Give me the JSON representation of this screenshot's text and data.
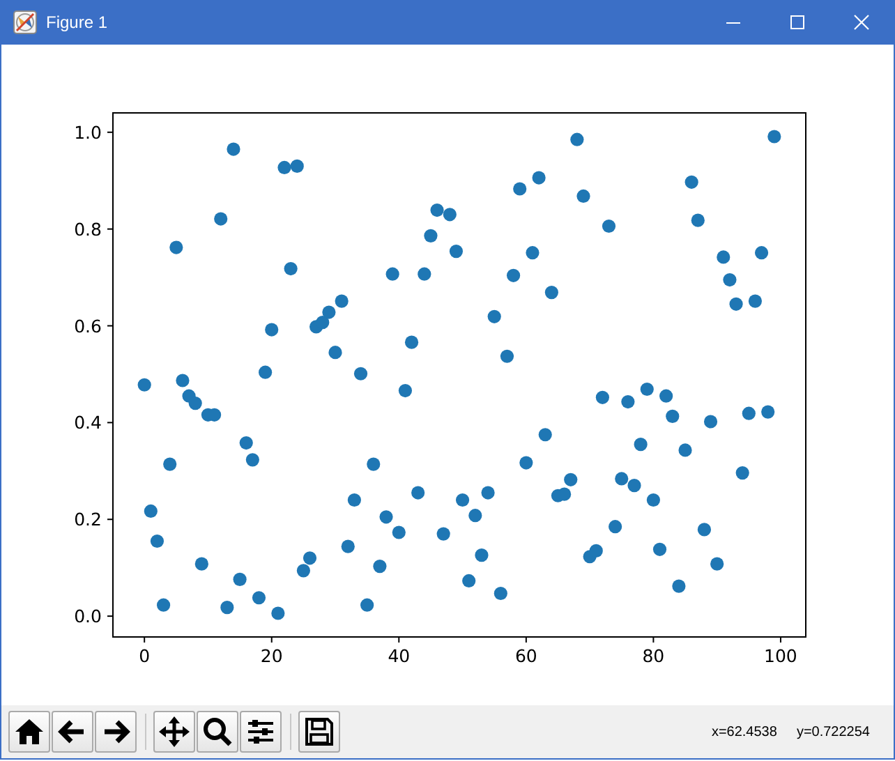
{
  "window": {
    "title": "Figure 1",
    "controls": [
      {
        "kind": "minimize"
      },
      {
        "kind": "maximize"
      },
      {
        "kind": "close"
      }
    ]
  },
  "plot": {
    "chart_data": {
      "type": "scatter",
      "xlim": [
        -4.95,
        103.95
      ],
      "ylim": [
        -0.043,
        1.04
      ],
      "xticks": [
        0,
        20,
        40,
        60,
        80,
        100
      ],
      "yticks": [
        {
          "value": 0,
          "label": "0.0"
        },
        {
          "value": 0.2,
          "label": "0.2"
        },
        {
          "value": 0.4,
          "label": "0.4"
        },
        {
          "value": 0.6,
          "label": "0.6"
        },
        {
          "value": 0.8,
          "label": "0.8"
        },
        {
          "value": 1,
          "label": "1.0"
        }
      ],
      "x": [
        0,
        1,
        2,
        3,
        4,
        5,
        6,
        7,
        8,
        9,
        10,
        11,
        12,
        13,
        14,
        15,
        16,
        17,
        18,
        19,
        20,
        21,
        22,
        23,
        24,
        25,
        26,
        27,
        28,
        29,
        30,
        31,
        32,
        33,
        34,
        35,
        36,
        37,
        38,
        39,
        40,
        41,
        42,
        43,
        44,
        45,
        46,
        47,
        48,
        49,
        50,
        51,
        52,
        53,
        54,
        55,
        56,
        57,
        58,
        59,
        60,
        61,
        62,
        63,
        64,
        65,
        66,
        67,
        68,
        69,
        70,
        71,
        72,
        73,
        74,
        75,
        76,
        77,
        78,
        79,
        80,
        81,
        82,
        83,
        84,
        85,
        86,
        87,
        88,
        89,
        90,
        91,
        92,
        93,
        94,
        95,
        96,
        97,
        98,
        99
      ],
      "series": [
        {
          "color": "#1f77b4",
          "values": [
            0.478,
            0.217,
            0.155,
            0.023,
            0.314,
            0.762,
            0.487,
            0.455,
            0.44,
            0.108,
            0.416,
            0.416,
            0.821,
            0.018,
            0.965,
            0.076,
            0.358,
            0.323,
            0.038,
            0.504,
            0.592,
            0.006,
            0.927,
            0.718,
            0.93,
            0.094,
            0.12,
            0.598,
            0.607,
            0.628,
            0.545,
            0.651,
            0.144,
            0.24,
            0.501,
            0.023,
            0.314,
            0.103,
            0.205,
            0.707,
            0.173,
            0.466,
            0.566,
            0.255,
            0.707,
            0.786,
            0.839,
            0.17,
            0.83,
            0.754,
            0.24,
            0.073,
            0.208,
            0.126,
            0.255,
            0.619,
            0.047,
            0.537,
            0.704,
            0.883,
            0.317,
            0.751,
            0.906,
            0.375,
            0.669,
            0.249,
            0.252,
            0.282,
            0.985,
            0.868,
            0.123,
            0.135,
            0.452,
            0.806,
            0.185,
            0.284,
            0.443,
            0.27,
            0.355,
            0.469,
            0.24,
            0.138,
            0.455,
            0.413,
            0.062,
            0.343,
            0.897,
            0.818,
            0.179,
            0.402,
            0.108,
            0.742,
            0.695,
            0.645,
            0.296,
            0.419,
            0.651,
            0.751,
            0.422,
            0.991
          ]
        }
      ]
    }
  },
  "toolbar": {
    "groups": [
      {
        "buttons": [
          {
            "kind": "home"
          },
          {
            "kind": "back"
          },
          {
            "kind": "forward"
          }
        ]
      },
      {
        "buttons": [
          {
            "kind": "pan"
          },
          {
            "kind": "zoom"
          },
          {
            "kind": "configure"
          }
        ]
      },
      {
        "buttons": [
          {
            "kind": "save"
          }
        ]
      }
    ],
    "coordinates": [
      "x=62.4538",
      "y=0.722254"
    ]
  }
}
